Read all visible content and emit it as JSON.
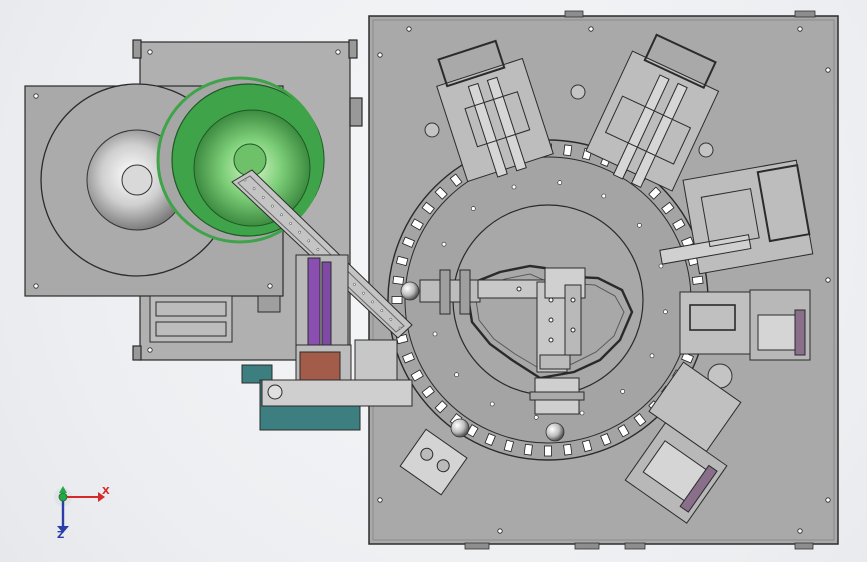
{
  "viewport": {
    "background": "#eceef1",
    "assembly": {
      "plate_color": "#a8a8a8",
      "line_color": "#2c2c2c",
      "green_bowl_color": "#3fa34a",
      "purple_color": "#8a4fb0",
      "teal_color": "#3d7f80"
    }
  },
  "triad": {
    "x_label": "X",
    "z_label": "Z",
    "x_color": "#d62a2a",
    "y_color": "#28a745",
    "z_color": "#2b3ea8"
  }
}
